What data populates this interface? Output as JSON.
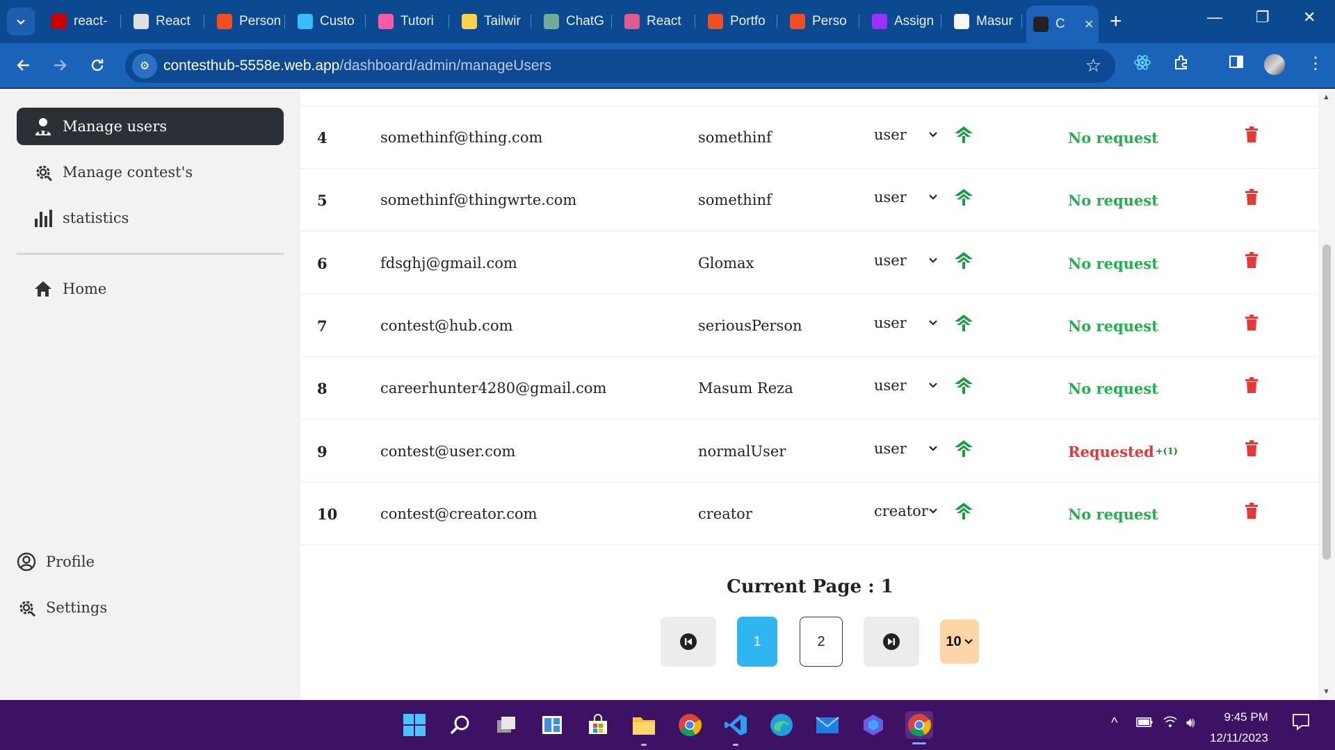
{
  "browser": {
    "tabs": [
      {
        "title": "react-",
        "favicon": "npm-icon",
        "color": "#cb0000"
      },
      {
        "title": "React",
        "favicon": "github-icon",
        "color": "#e0e0e0"
      },
      {
        "title": "Person",
        "favicon": "figma-icon",
        "color": "#f24e1e"
      },
      {
        "title": "Custo",
        "favicon": "wave-icon",
        "color": "#38bdf8"
      },
      {
        "title": "Tutori",
        "favicon": "dots-icon",
        "color": "#ff5aa5"
      },
      {
        "title": "Tailwir",
        "favicon": "bulb-icon",
        "color": "#fcd34d"
      },
      {
        "title": "ChatG",
        "favicon": "openai-icon",
        "color": "#74aa9c"
      },
      {
        "title": "React",
        "favicon": "react-icon",
        "color": "#e25b8e"
      },
      {
        "title": "Portfo",
        "favicon": "figma-icon",
        "color": "#f24e1e"
      },
      {
        "title": "Perso",
        "favicon": "figma-icon",
        "color": "#f24e1e"
      },
      {
        "title": "Assign",
        "favicon": "play-icon",
        "color": "#9b30ff"
      },
      {
        "title": "Masur",
        "favicon": "avatar-icon",
        "color": "#f5f5f5"
      },
      {
        "title": "C",
        "favicon": "contesthub-icon",
        "color": "#222222"
      }
    ],
    "url_host": "contesthub-5558e.web.app",
    "url_path": "/dashboard/admin/manageUsers"
  },
  "sidebar": {
    "items": [
      {
        "label": "Manage users",
        "icon": "users-icon"
      },
      {
        "label": "Manage contest's",
        "icon": "gear-icon"
      },
      {
        "label": "statistics",
        "icon": "bar-chart-icon"
      },
      {
        "label": "Home",
        "icon": "home-icon"
      },
      {
        "label": "Profile",
        "icon": "user-circle-icon"
      },
      {
        "label": "Settings",
        "icon": "gear-icon"
      }
    ]
  },
  "table": {
    "rows": [
      {
        "idx": "4",
        "email": "somethinf@thing.com",
        "name": "somethinf",
        "role": "user",
        "status": "No request",
        "requested": false
      },
      {
        "idx": "5",
        "email": "somethinf@thingwrte.com",
        "name": "somethinf",
        "role": "user",
        "status": "No request",
        "requested": false
      },
      {
        "idx": "6",
        "email": "fdsghj@gmail.com",
        "name": "Glomax",
        "role": "user",
        "status": "No request",
        "requested": false
      },
      {
        "idx": "7",
        "email": "contest@hub.com",
        "name": "seriousPerson",
        "role": "user",
        "status": "No request",
        "requested": false
      },
      {
        "idx": "8",
        "email": "careerhunter4280@gmail.com",
        "name": "Masum Reza",
        "role": "user",
        "status": "No request",
        "requested": false
      },
      {
        "idx": "9",
        "email": "contest@user.com",
        "name": "normalUser",
        "role": "user",
        "status": "Requested",
        "badge": "+(1)",
        "requested": true
      },
      {
        "idx": "10",
        "email": "contest@creator.com",
        "name": "creator",
        "role": "creator",
        "status": "No request",
        "requested": false
      }
    ],
    "colors": {
      "no_request": "#22b14c",
      "requested": "#e53935",
      "delete": "#e53935",
      "promote": "#1a9b45"
    }
  },
  "pagination": {
    "current_label": "Current Page : 1",
    "pages": [
      "1",
      "2"
    ],
    "page_size": "10",
    "active_color": "#2fb6f0",
    "size_color": "#fdd5a6"
  },
  "taskbar": {
    "time": "9:45 PM",
    "date": "12/11/2023"
  }
}
